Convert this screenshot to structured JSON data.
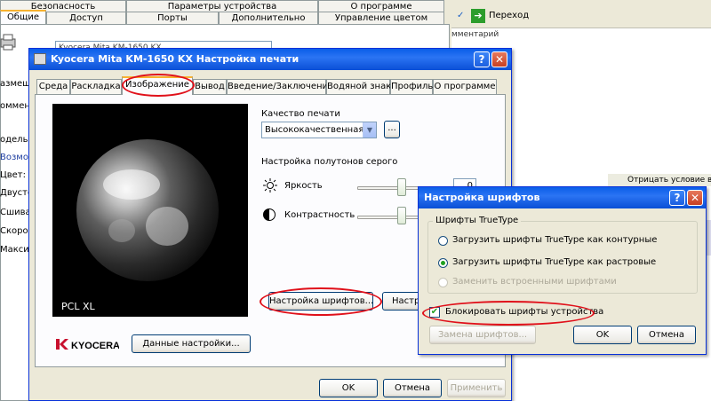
{
  "background_window": {
    "top_tabs_row1": [
      "Безопасность",
      "Параметры устройства",
      "О программе"
    ],
    "top_tabs_row2": [
      "Общие",
      "Доступ",
      "Порты",
      "Дополнительно",
      "Управление цветом"
    ],
    "model_field": "Kyocera Mita KM-1650 KX",
    "side_labels": [
      "азмеще",
      "омменг",
      "одель:",
      "Возмож",
      "Цвет: Н",
      "Двусто",
      "Сшиват",
      "Скорос",
      "Макси"
    ]
  },
  "right_window": {
    "go_label": "Переход",
    "comments_label": "мментарий",
    "list_item": "Отрицать условие вы"
  },
  "main_dialog": {
    "title": "Kyocera Mita KM-1650 KX Настройка печати",
    "help_symbol": "?",
    "close_symbol": "✕",
    "tabs": [
      "Среда",
      "Раскладка",
      "Изображение",
      "Вывод",
      "Введение/Заключение",
      "Водяной знак",
      "Профиль",
      "О программе"
    ],
    "active_tab": "Изображение",
    "preview_caption": "PCL XL",
    "print_quality_label": "Качество печати",
    "print_quality_value": "Высококачественная",
    "ellipsis_button": "...",
    "halftone_label": "Настройка полутонов серого",
    "brightness_label": "Яркость",
    "contrast_label": "Контрастность",
    "brightness_value": "0",
    "fonts_button": "Настройка шрифтов...",
    "other_button": "Настро",
    "logo_text": "KYOCERA",
    "data_settings_button": "Данные настройки...",
    "ok": "OK",
    "cancel": "Отмена",
    "apply": "Применить"
  },
  "font_dialog": {
    "title": "Настройка шрифтов",
    "help_symbol": "?",
    "close_symbol": "✕",
    "group_label": "Шрифты TrueType",
    "options": [
      "Загрузить шрифты TrueType как контурные",
      "Загрузить шрифты TrueType как растровые",
      "Заменить встроенными шрифтами"
    ],
    "selected_option": 1,
    "lock_fonts_label": "Блокировать шрифты устройства",
    "lock_fonts_checked": true,
    "replace_fonts_button": "Замена шрифтов...",
    "ok": "OK",
    "cancel": "Отмена"
  },
  "colors": {
    "title_bar": "#0a5ee8",
    "highlight_oval": "#e0101a",
    "dialog_face": "#ece9d8"
  }
}
